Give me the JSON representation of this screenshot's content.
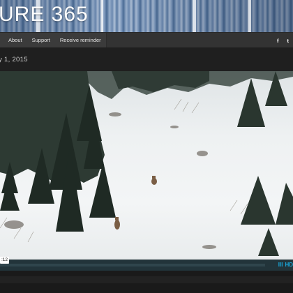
{
  "banner": {
    "title": "URE 365"
  },
  "nav": {
    "items": [
      {
        "label": "About"
      },
      {
        "label": "Support"
      },
      {
        "label": "Receive reminder"
      }
    ],
    "social": {
      "facebook": "f",
      "twitter": "t"
    }
  },
  "post": {
    "date": "y 1, 2015"
  },
  "video": {
    "current_time": ":12",
    "quality_icon": "III",
    "hd_label": "HD"
  },
  "colors": {
    "accent": "#19a7d9",
    "nav_bg": "#333333",
    "page_bg": "#1c1c1c"
  }
}
